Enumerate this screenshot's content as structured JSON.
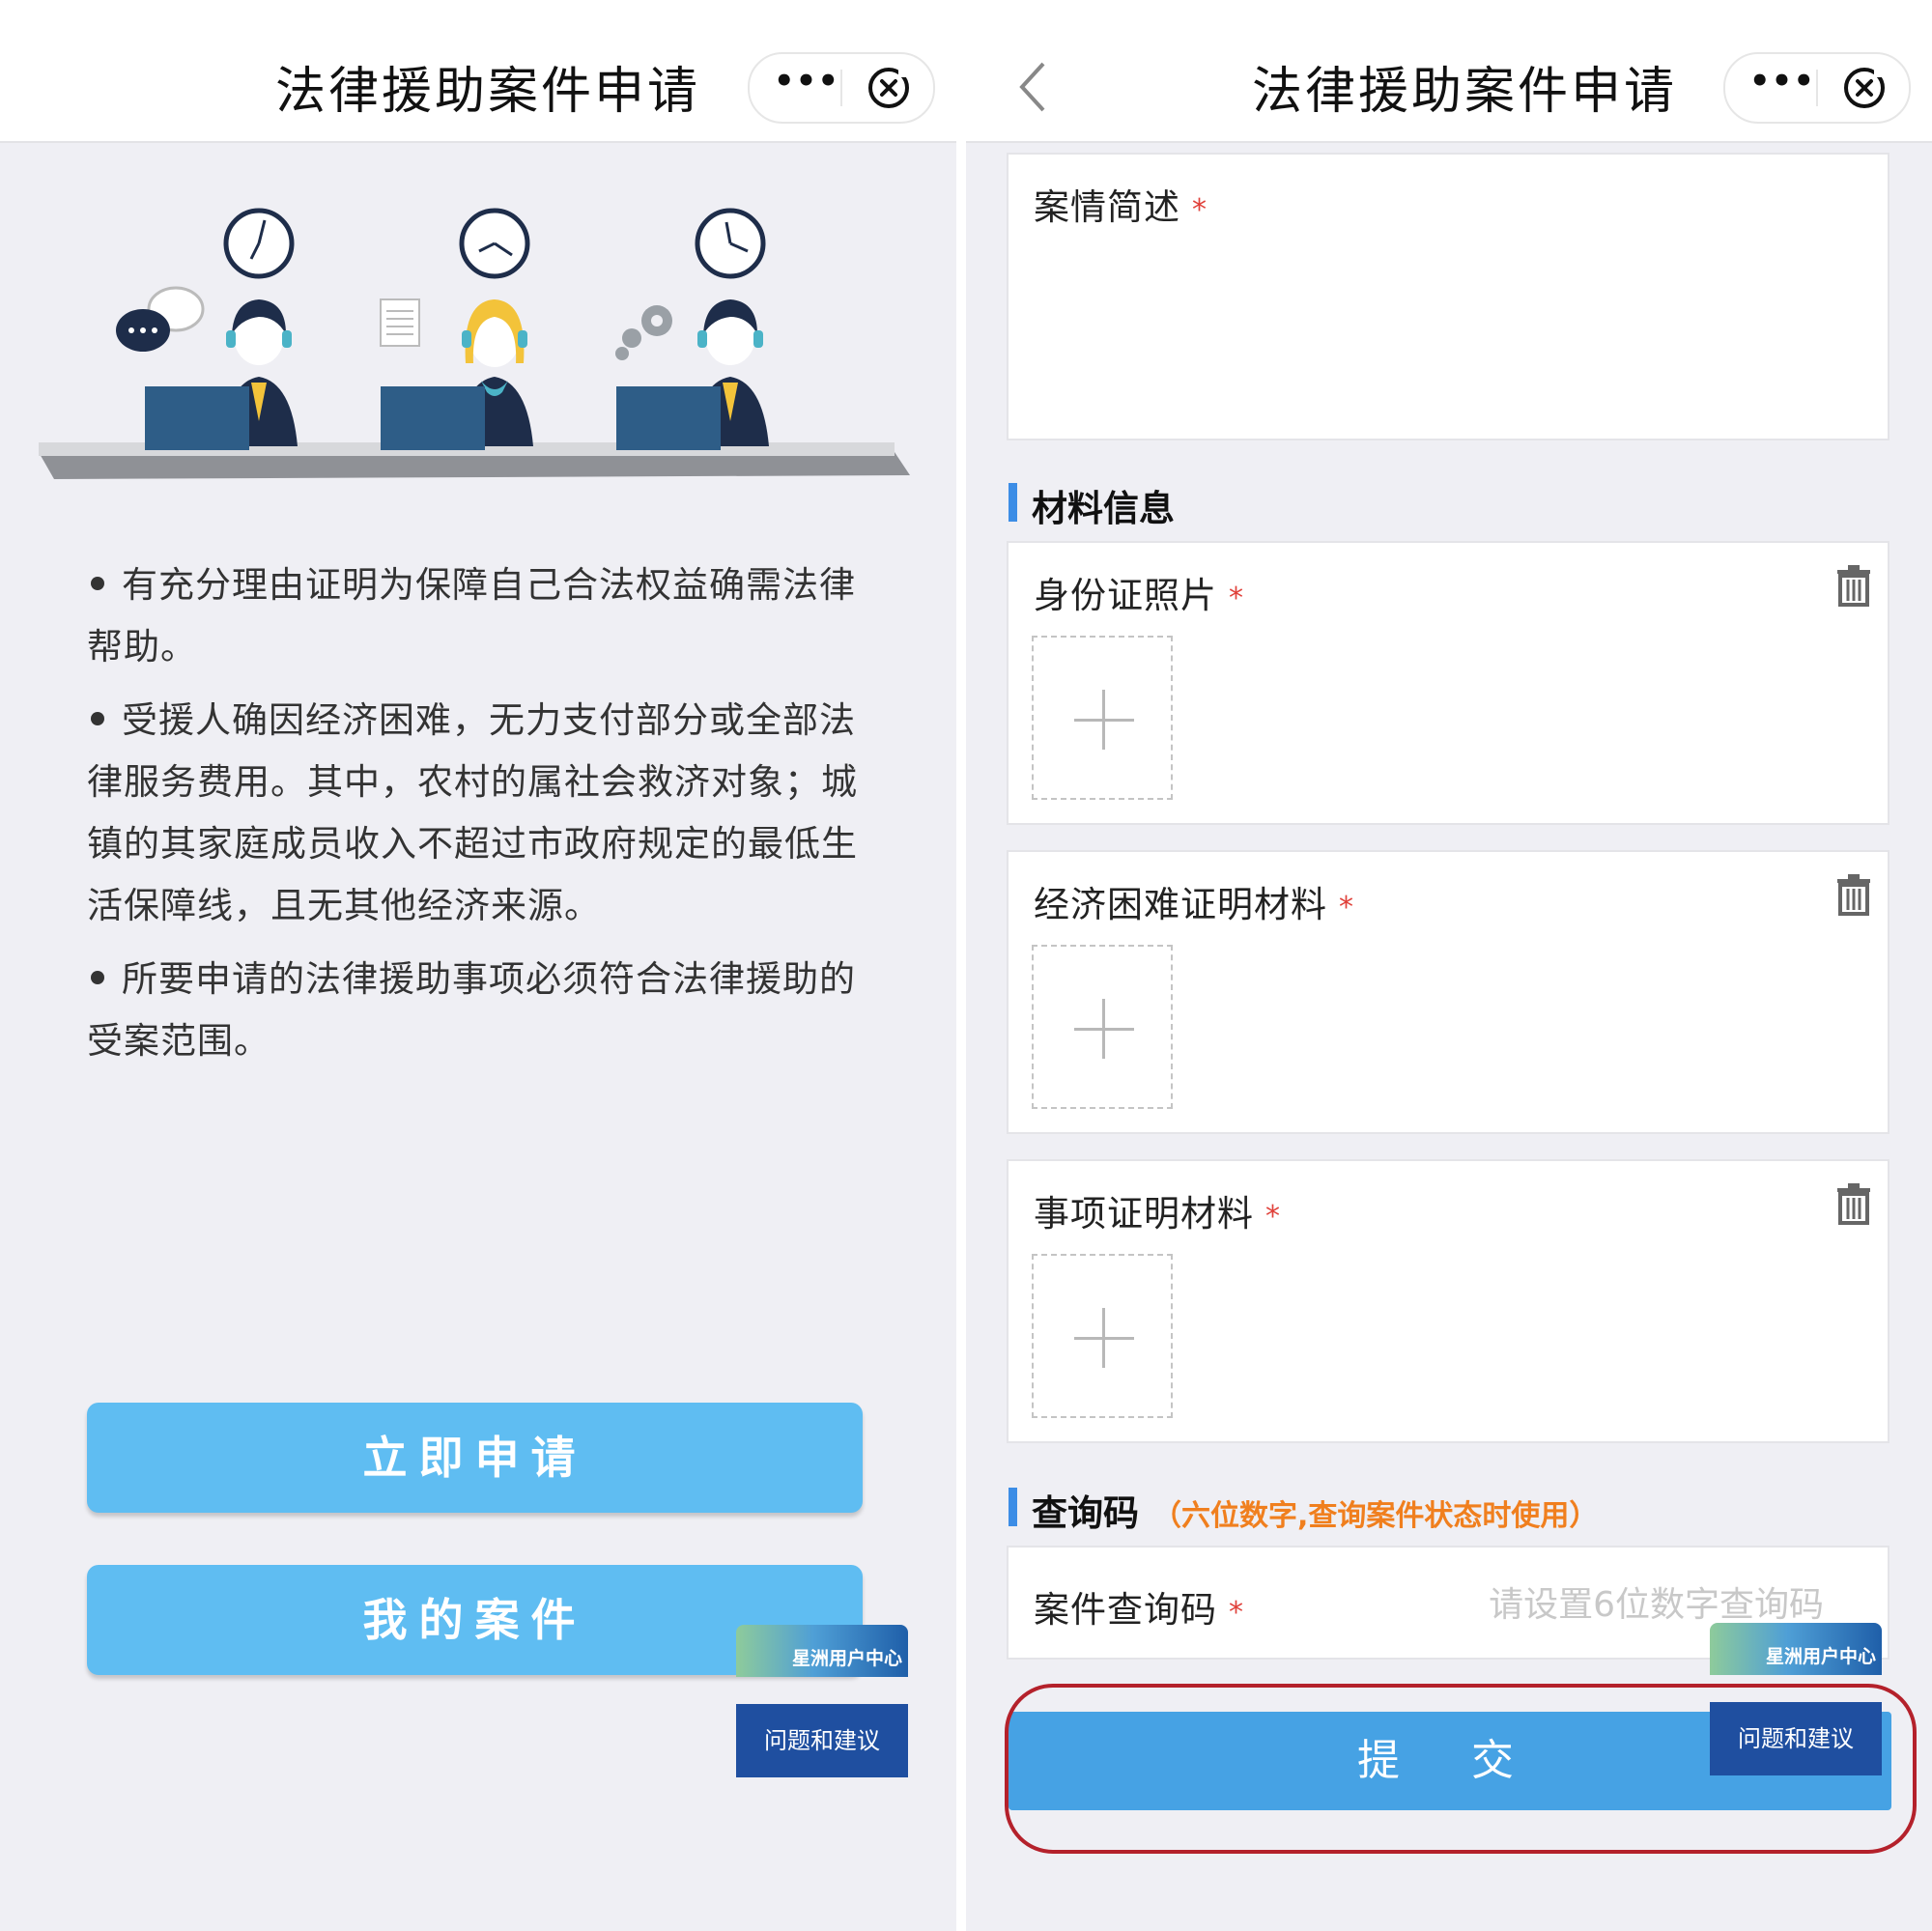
{
  "left": {
    "title": "法律援助案件申请",
    "rules": [
      "有充分理由证明为保障自己合法权益确需法律帮助。",
      "受援人确因经济困难，无力支付部分或全部法律服务费用。其中，农村的属社会救济对象；城镇的其家庭成员收入不超过市政府规定的最低生活保障线，且无其他经济来源。",
      "所要申请的法律援助事项必须符合法律援助的受案范围。"
    ],
    "apply_button": "立即申请",
    "my_cases_button": "我的案件",
    "badge": "星洲用户中心",
    "feedback_button": "问题和建议"
  },
  "right": {
    "title": "法律援助案件申请",
    "case_summary_label": "案情简述",
    "required_mark": "*",
    "materials_section": "材料信息",
    "id_photo_label": "身份证照片",
    "hardship_label": "经济困难证明材料",
    "matter_label": "事项证明材料",
    "query_section": "查询码",
    "query_hint": "（六位数字,查询案件状态时使用）",
    "query_code_label": "案件查询码",
    "query_code_placeholder": "请设置6位数字查询码",
    "submit_button": "提 交",
    "badge": "星洲用户中心",
    "feedback_button": "问题和建议"
  },
  "icons": {
    "more": "more-dots-icon",
    "close": "close-circle-icon",
    "back": "chevron-left-icon",
    "trash": "trash-icon",
    "plus": "plus-icon"
  },
  "colors": {
    "primary_button": "#5fbdf2",
    "submit_button": "#46a2e4",
    "section_bar": "#3c8de6",
    "required": "#e0413a",
    "hint": "#f07f1e",
    "feedback": "#1f4fa0",
    "highlight": "#b4212b"
  }
}
